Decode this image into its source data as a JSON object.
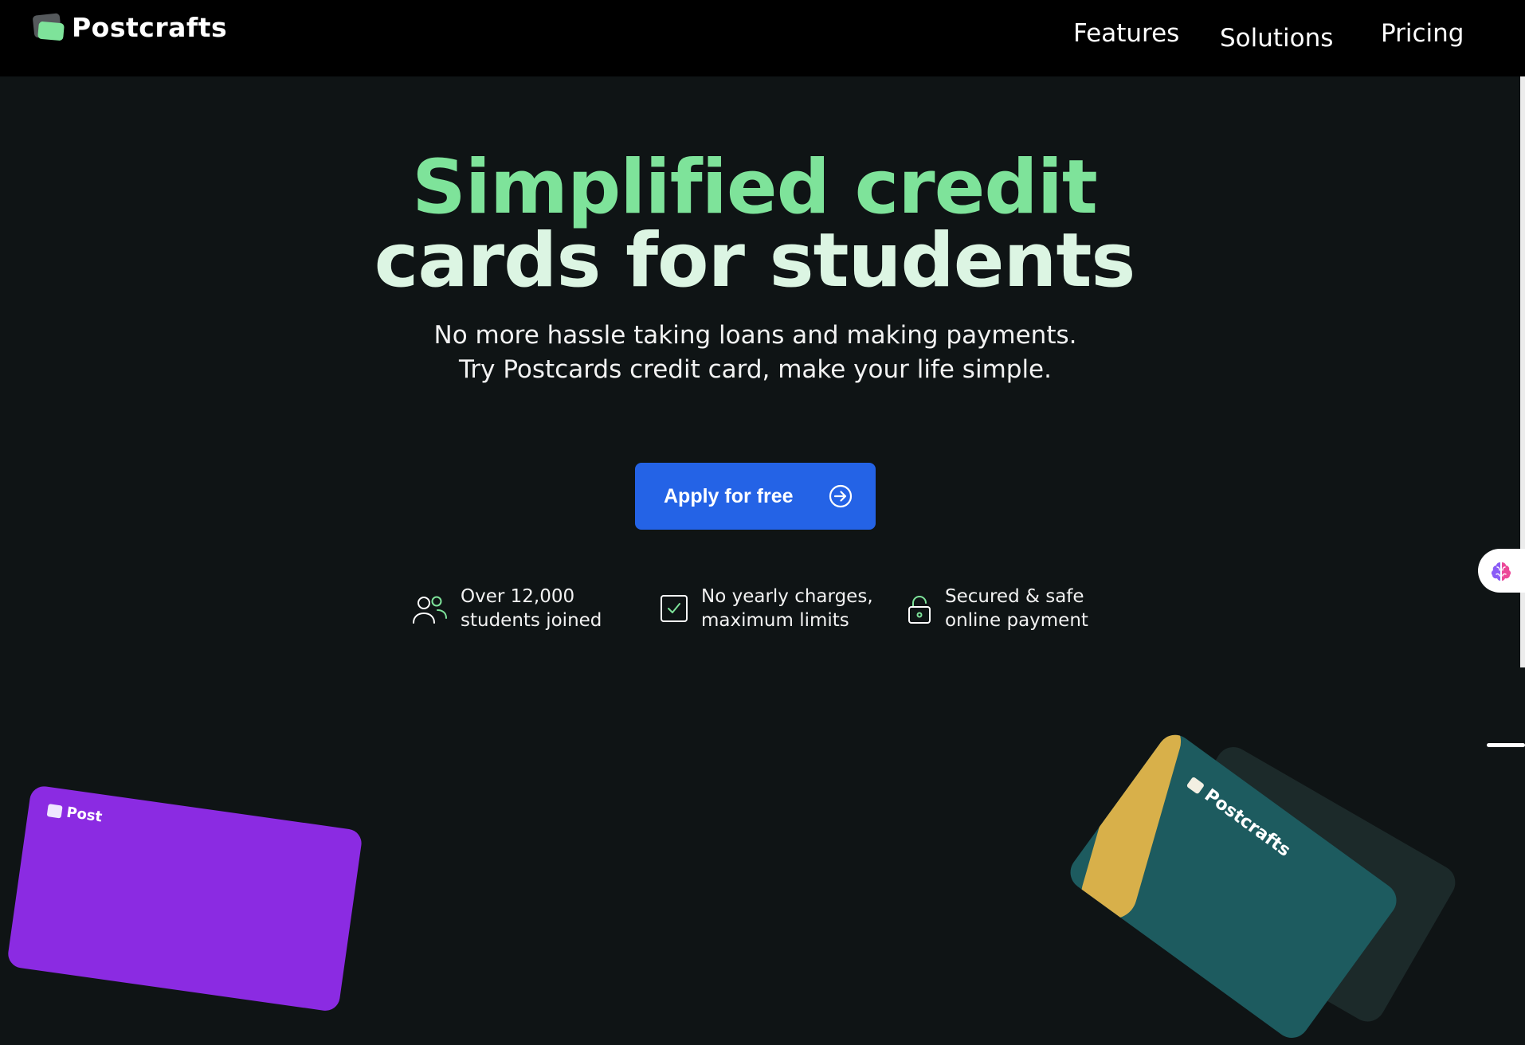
{
  "brand": {
    "name": "Postcrafts"
  },
  "nav": {
    "items": [
      {
        "label": "Features"
      },
      {
        "label": "Solutions"
      },
      {
        "label": "Pricing"
      }
    ]
  },
  "hero": {
    "title_line1": "Simplified credit",
    "title_line2": "cards for students",
    "subtitle": "No more hassle taking loans and making payments. Try Postcards credit card, make your life simple.",
    "cta_label": "Apply for free",
    "cta_icon": "arrow-right-circle-icon"
  },
  "features": [
    {
      "icon": "users-icon",
      "line1": "Over 12,000",
      "line2": "students joined"
    },
    {
      "icon": "checkbox-icon",
      "line1": "No yearly charges,",
      "line2": "maximum limits"
    },
    {
      "icon": "lock-icon",
      "line1": "Secured & safe",
      "line2": "online payment"
    }
  ],
  "cards": {
    "left_card_brand": "Post",
    "right_card_brand": "Postcrafts"
  },
  "colors": {
    "accent_green": "#7ee39a",
    "title_light": "#dcf5e3",
    "cta_blue": "#2463e6",
    "card_purple": "#8b2be2",
    "card_teal": "#1d5b5f",
    "card_gold": "#d8b04a",
    "background": "#0f1415",
    "header": "#000000"
  }
}
